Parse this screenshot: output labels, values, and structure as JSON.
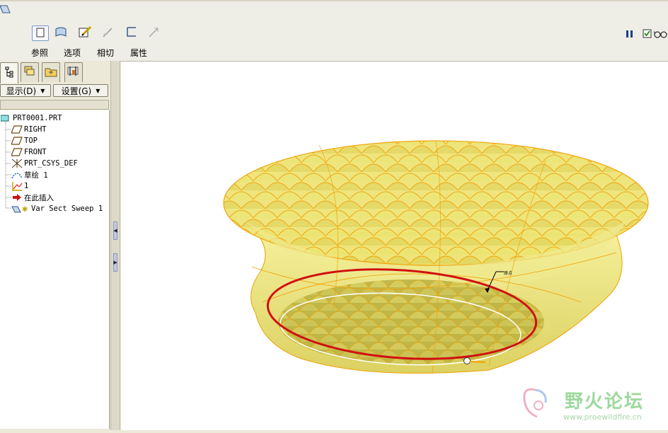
{
  "dashboard": {
    "tabs": [
      {
        "label": "参照",
        "icon": "reference-icon",
        "active": true
      },
      {
        "label": "选项",
        "icon": "options-icon",
        "active": false
      },
      {
        "label": "相切",
        "icon": "tangency-icon",
        "active": false
      },
      {
        "label": "属性",
        "icon": "properties-icon",
        "active": false
      }
    ],
    "right_controls": [
      "pause-icon",
      "verify-checkbox-icon",
      "preview-glasses-icon"
    ]
  },
  "navigator": {
    "tabs": [
      "model-tree-tab-icon",
      "layers-tab-icon",
      "folder-browser-tab-icon",
      "favorites-tab-icon"
    ],
    "show_menu": "显示(D)",
    "settings_menu": "设置(G)",
    "tree": [
      {
        "label": "PRT0001.PRT",
        "icon": "part-icon",
        "level": 0
      },
      {
        "label": "RIGHT",
        "icon": "datum-plane-icon",
        "level": 1
      },
      {
        "label": "TOP",
        "icon": "datum-plane-icon",
        "level": 1
      },
      {
        "label": "FRONT",
        "icon": "datum-plane-icon",
        "level": 1
      },
      {
        "label": "PRT_CSYS_DEF",
        "icon": "csys-icon",
        "level": 1
      },
      {
        "label": "草绘 1",
        "icon": "sketch-icon",
        "level": 1
      },
      {
        "label": "1",
        "icon": "graph-icon",
        "level": 1
      },
      {
        "label": "在此插入",
        "icon": "insert-here-arrow-icon",
        "level": 1
      },
      {
        "label": "Var Sect Sweep 1",
        "icon": "var-sect-sweep-icon",
        "level": 1
      }
    ]
  },
  "viewport": {
    "annotation_label": "原点",
    "watermark": {
      "title": "野火论坛",
      "url": "www.proewildfire.cn"
    }
  },
  "colors": {
    "surface_fill": "#e8e070",
    "edge_orange": "#f0a000",
    "trajectory_red": "#d01010",
    "watermark_green": "#8cd28c"
  }
}
